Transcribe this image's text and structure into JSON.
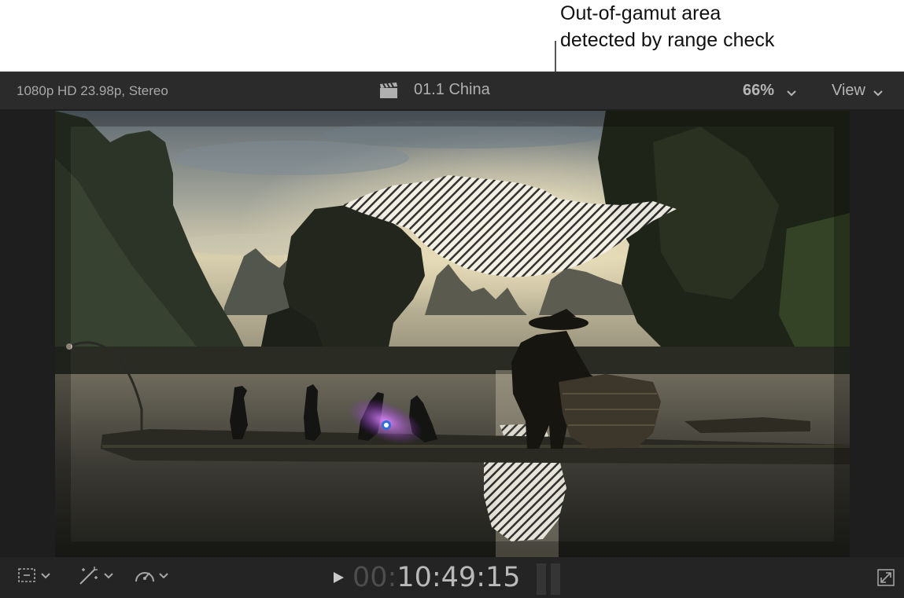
{
  "callout": {
    "line1": "Out-of-gamut area",
    "line2": "detected by range check"
  },
  "header": {
    "format": "1080p HD 23.98p, Stereo",
    "clip_title": "01.1 China",
    "zoom": "66%",
    "view_label": "View"
  },
  "toolbar": {
    "timecode_dim": "00:",
    "timecode_main": "10:49:15"
  },
  "icons": {
    "clapper": "clapperboard-icon",
    "transform": "transform-overlay-icon",
    "enhance": "magic-wand-icon",
    "retime": "speedometer-icon",
    "play": "play-icon",
    "fullscreen": "fullscreen-icon"
  }
}
